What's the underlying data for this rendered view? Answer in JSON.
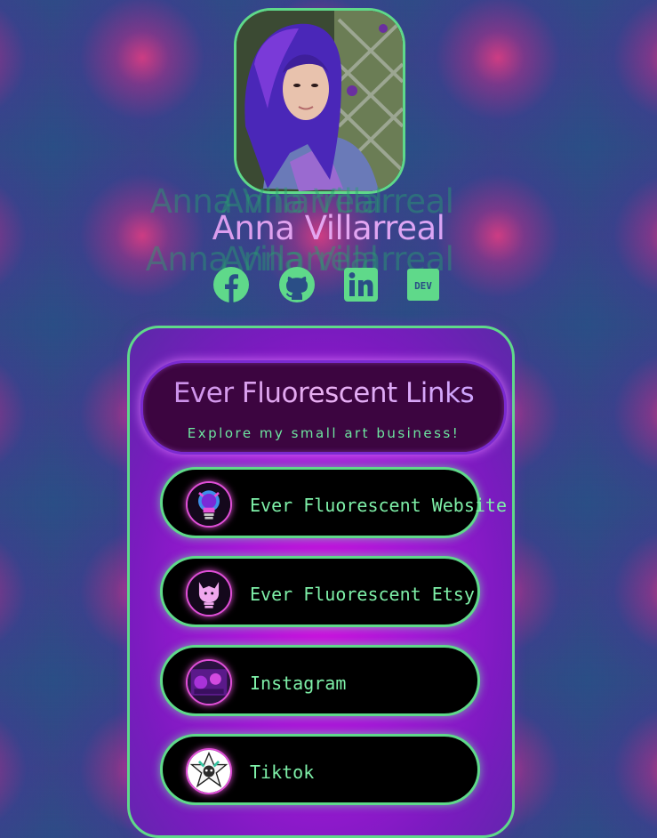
{
  "profile": {
    "name": "Anna Villarreal",
    "avatar_alt": "profile-photo"
  },
  "socials": [
    {
      "name": "facebook-icon"
    },
    {
      "name": "github-icon"
    },
    {
      "name": "linkedin-icon"
    },
    {
      "name": "dev-icon",
      "text": "DEV"
    }
  ],
  "card": {
    "title": "Ever Fluorescent Links",
    "subtitle": "Explore my small art business!"
  },
  "links": [
    {
      "label": "Ever Fluorescent Website",
      "icon": "bulb-logo-icon"
    },
    {
      "label": "Ever Fluorescent Etsy",
      "icon": "bulb-cat-icon"
    },
    {
      "label": "Instagram",
      "icon": "instagram-photo-icon"
    },
    {
      "label": "Tiktok",
      "icon": "tiktok-avatar-icon"
    }
  ],
  "colors": {
    "accent_green": "#5fd98a",
    "text_green": "#7ef0a8",
    "name_purple": "#c98af0",
    "card_magenta": "#d20fe0",
    "header_bg": "#3c0540"
  }
}
